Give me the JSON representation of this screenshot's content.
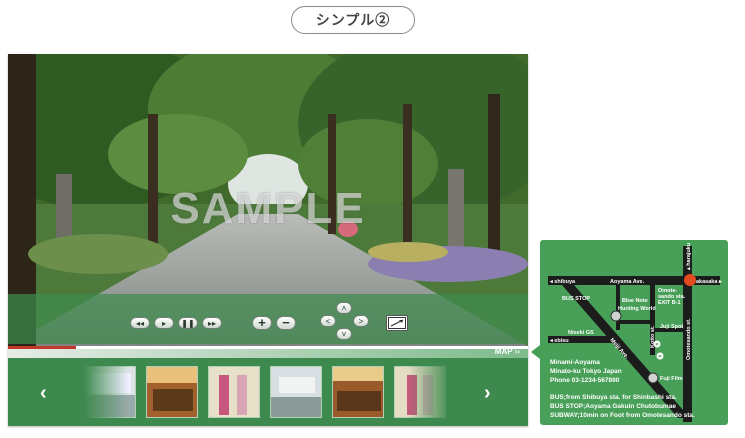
{
  "title": "シンプル②",
  "viewer": {
    "watermark": "SAMPLE",
    "map_toggle_label": "MAP",
    "progress": 0.13,
    "controls": {
      "rewind": "◂◂",
      "play": "▸",
      "pause": "❚❚",
      "forward": "▸▸",
      "zoom_in": "+",
      "zoom_out": "−",
      "up": "˄",
      "left": "<",
      "right": ">",
      "down": "˅"
    },
    "thumbs_prev": "‹",
    "thumbs_next": "›"
  },
  "map": {
    "streets": {
      "shibuya": "◂ shibuya",
      "aoyama": "Aoyama Ave.",
      "akasaka": "akasaka ▸",
      "ebisu": "◂ ebisu",
      "meiji": "Meiji Ave.",
      "omotesando": "Omotesando st.",
      "kotto": "Kotto st.",
      "harajuku": "▴ harajuku"
    },
    "landmarks": {
      "bus_stop": "BUS STOP",
      "blue_note": "Blue Note",
      "hunting_world": "Hunting World",
      "omotesando_exit1": "Omote-",
      "omotesando_exit2": "sando sta.",
      "omotesando_exit3": "EXIT B-1",
      "juji_spot": "Juji Spot",
      "niseki": "Niseki GS",
      "fuji_film": "Fuji Film",
      "p1": "P",
      "p2": "P"
    }
  },
  "info": {
    "line1": "Minami-Aoyama",
    "line2": "Minato-ku Tokyo Japan",
    "line3": "Phone 03-1234-567890",
    "line4": "BUS;from Shibuya sta. for Shinbashi sta.",
    "line5": "BUS STOP;Aoyama Gakuin Chutobumae",
    "line6": "SUBWAY;10min on Foot from Omotesando sta."
  }
}
